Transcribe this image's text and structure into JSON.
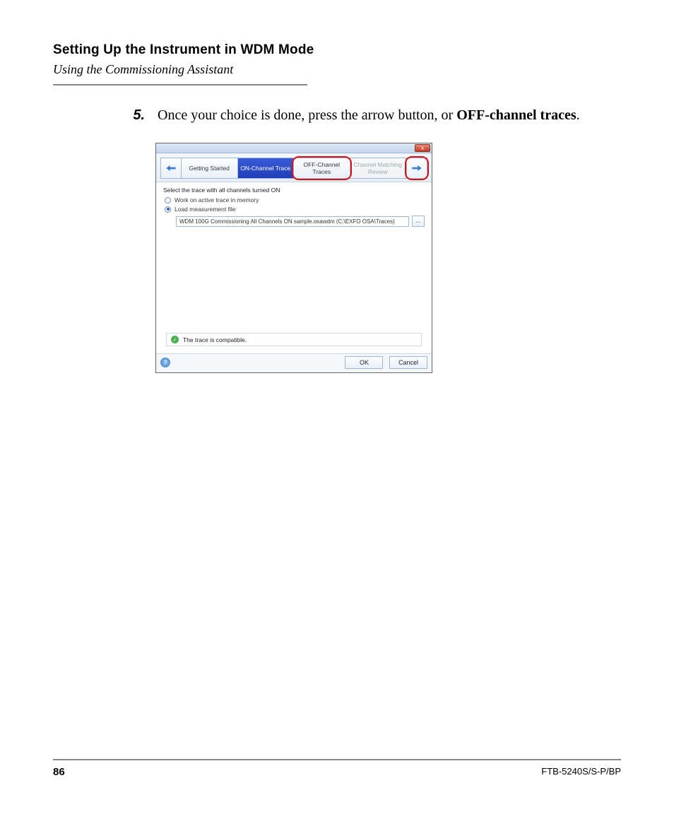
{
  "header": {
    "title": "Setting Up the Instrument in WDM Mode",
    "subtitle": "Using the Commissioning Assistant"
  },
  "step": {
    "number": "5.",
    "text_pre": "Once your choice is done, press the arrow button, or ",
    "text_bold": "OFF-channel traces",
    "text_post": "."
  },
  "dialog": {
    "close_glyph": "x",
    "nav": {
      "back_label": "",
      "tabs": [
        {
          "label": "Getting Started",
          "state": "normal"
        },
        {
          "label": "ON-Channel Trace",
          "state": "active"
        },
        {
          "label": "OFF-Channel Traces",
          "state": "normal",
          "highlight": true
        },
        {
          "label": "Channel Matching Review",
          "state": "faded"
        }
      ],
      "next_highlight": true
    },
    "instruction": "Select the trace with all channels turned ON",
    "radios": {
      "work_active": {
        "label": "Work on active trace in memory",
        "selected": false
      },
      "load_file": {
        "label": "Load measurement file",
        "selected": true
      }
    },
    "file_path": "WDM 100G Commissioning All Channels ON sample.osawdm (C:\\EXFO OSA\\Traces)",
    "browse_label": "...",
    "status": "The trace is compatible.",
    "buttons": {
      "ok": "OK",
      "cancel": "Cancel"
    }
  },
  "footer": {
    "page": "86",
    "model": "FTB-5240S/S-P/BP"
  }
}
